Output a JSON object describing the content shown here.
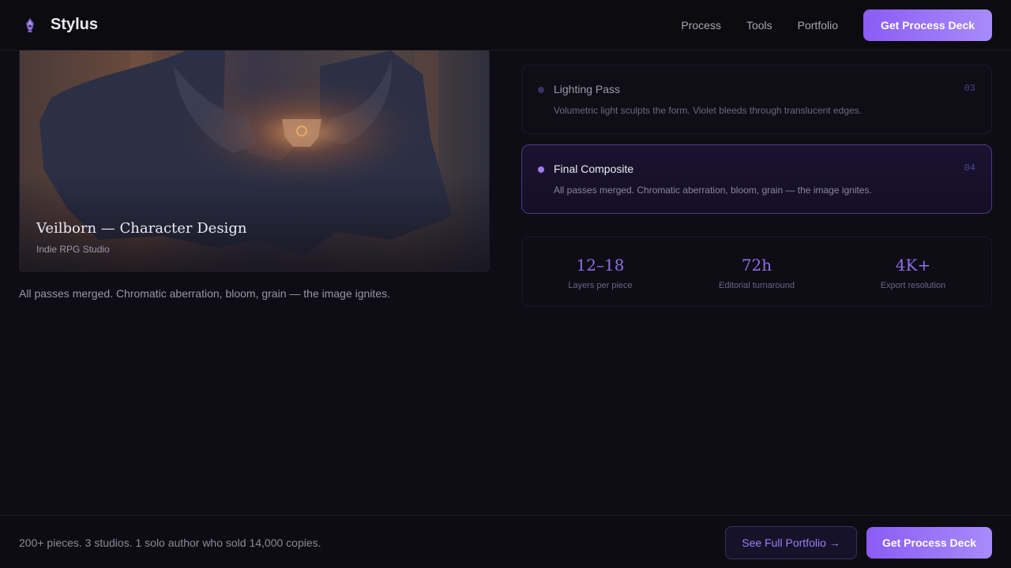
{
  "brand": {
    "name": "Stylus",
    "icon": "quill-pen-icon"
  },
  "nav": {
    "links": [
      "Process",
      "Tools",
      "Portfolio"
    ],
    "cta_label": "Get Process Deck"
  },
  "hero": {
    "title": "Veilborn — Character Design",
    "subtitle": "Indie RPG Studio",
    "caption": "All passes merged. Chromatic aberration, bloom, grain — the image ignites."
  },
  "steps": [
    {
      "title": "Lighting Pass",
      "description": "Volumetric light sculpts the form. Violet bleeds through translucent edges.",
      "number": "03",
      "active": false
    },
    {
      "title": "Final Composite",
      "description": "All passes merged. Chromatic aberration, bloom, grain — the image ignites.",
      "number": "04",
      "active": true
    }
  ],
  "stats": [
    {
      "value": "12–18",
      "label": "Layers per piece"
    },
    {
      "value": "72h",
      "label": "Editorial turnaround"
    },
    {
      "value": "4K+",
      "label": "Export resolution"
    }
  ],
  "footer": {
    "text": "200+ pieces. 3 studios. 1 solo author who sold 14,000 copies.",
    "secondary_label": "See Full Portfolio →",
    "primary_label": "Get Process Deck"
  },
  "colors": {
    "accent": "#8b5cf6",
    "accent_light": "#a78bfa",
    "background": "#0e0c14"
  }
}
